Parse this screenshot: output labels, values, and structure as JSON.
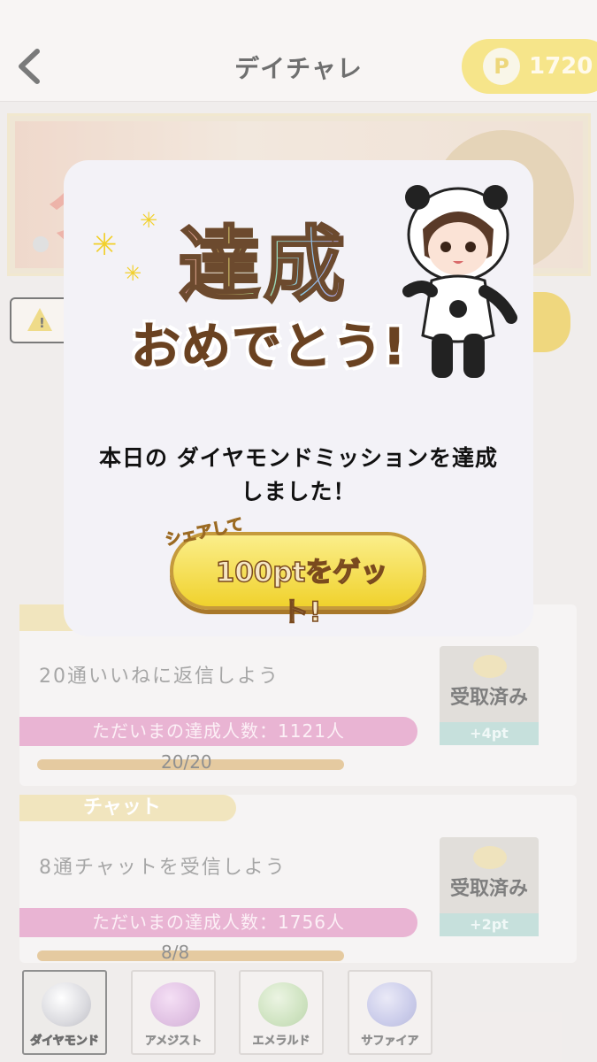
{
  "header": {
    "title": "デイチャレ",
    "points": "1720",
    "points_icon_letter": "P"
  },
  "notice_icon": "warning-icon",
  "missions": [
    {
      "category": "",
      "text": "20通いいねに返信しよう",
      "achievers": "ただいまの達成人数：1121人",
      "progress_label": "20/20",
      "progress": 1.0,
      "reward_label": "受取済み",
      "reward_points": "+4pt"
    },
    {
      "category": "チャット",
      "text": "8通チャットを受信しよう",
      "achievers": "ただいまの達成人数：1756人",
      "progress_label": "8/8",
      "progress": 1.0,
      "reward_label": "受取済み",
      "reward_points": "+2pt"
    }
  ],
  "gems": [
    {
      "label": "ダイヤモンド",
      "color": "#d9d9dd",
      "selected": true
    },
    {
      "label": "アメジスト",
      "color": "#c98fd0",
      "selected": false
    },
    {
      "label": "エメラルド",
      "color": "#a8d08f",
      "selected": false
    },
    {
      "label": "サファイア",
      "color": "#9fa3dd",
      "selected": false
    }
  ],
  "modal": {
    "headline": "達成",
    "subheadline": "おめでとう!",
    "message_line1": "本日の ダイヤモンドミッションを達成",
    "message_line2": "しました！",
    "share_small": "シェアして",
    "share_main": "100ptをゲット!"
  },
  "colors": {
    "accent_yellow": "#f2d74c",
    "pink": "#dd8cbc",
    "progress": "#d8ae6e"
  }
}
